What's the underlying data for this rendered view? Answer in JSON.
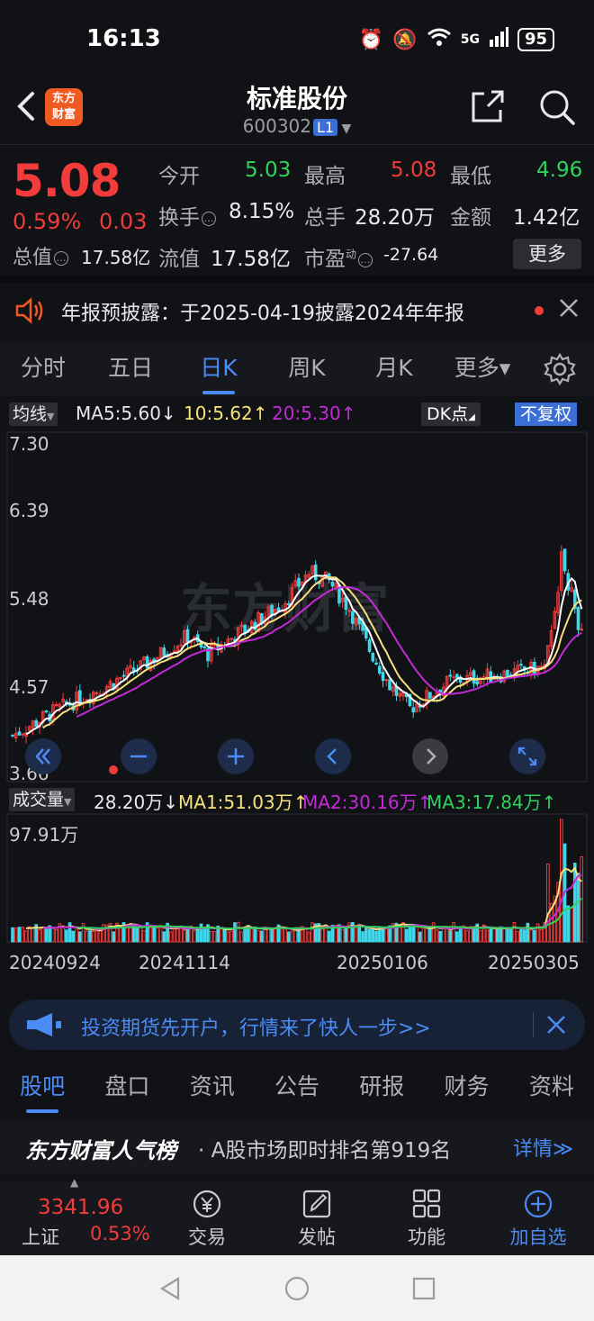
{
  "status": {
    "time": "16:13",
    "battery": "95",
    "network": "5G"
  },
  "header": {
    "title": "标准股份",
    "code": "600302",
    "level": "L1",
    "logo_line1": "东方",
    "logo_line2": "财富"
  },
  "quote": {
    "price": "5.08",
    "change_pct": "0.59%",
    "change_amt": "0.03",
    "open_label": "今开",
    "open": "5.03",
    "high_label": "最高",
    "high": "5.08",
    "low_label": "最低",
    "low": "4.96",
    "turnover_label": "换手",
    "turnover": "8.15%",
    "volume_label": "总手",
    "volume": "28.20万",
    "amount_label": "金额",
    "amount": "1.42亿",
    "total_mv_label": "总值",
    "total_mv": "17.58亿",
    "float_mv_label": "流值",
    "float_mv": "17.58亿",
    "pe_label": "市盈",
    "pe_sup": "动",
    "pe": "-27.64",
    "more_label": "更多"
  },
  "notice": {
    "text": "年报预披露：于2025-04-19披露2024年年报"
  },
  "chart_tabs": [
    "分时",
    "五日",
    "日K",
    "周K",
    "月K",
    "更多▾"
  ],
  "kline": {
    "ma_select": "均线",
    "ma5": "MA5:5.60↓",
    "ma10": "10:5.62↑",
    "ma20": "20:5.30↑",
    "dk_label": "DK点",
    "adjust_label": "不复权",
    "y_ticks": [
      "7.30",
      "6.39",
      "5.48",
      "4.57",
      "3.66"
    ],
    "watermark": "东方财富"
  },
  "volume": {
    "select": "成交量",
    "vol": "28.20万↓",
    "ma1": "MA1:51.03万↑",
    "ma2": "MA2:30.16万↑",
    "ma3": "MA3:17.84万↑",
    "max_label": "97.91万",
    "dates": [
      "20240924",
      "20241114",
      "20250106",
      "20250305"
    ]
  },
  "colors": {
    "up": "#f23b3b",
    "down": "#3fd6e8",
    "ma5": "#ffffff",
    "ma10": "#f6e27a",
    "ma20": "#c42ad8",
    "accent": "#4a8bf5"
  },
  "ad": {
    "text": "投资期货先开户，行情来了快人一步>>"
  },
  "info_tabs": [
    "股吧",
    "盘口",
    "资讯",
    "公告",
    "研报",
    "财务",
    "资料"
  ],
  "popularity": {
    "brand": "东方财富人气榜",
    "text": "· A股市场即时排名第919名",
    "detail": "详情≫"
  },
  "bottom_nav": {
    "index_value": "3341.96",
    "index_name": "上证",
    "index_pct": "0.53%",
    "trade": "交易",
    "post": "发帖",
    "func": "功能",
    "add": "加自选"
  }
}
